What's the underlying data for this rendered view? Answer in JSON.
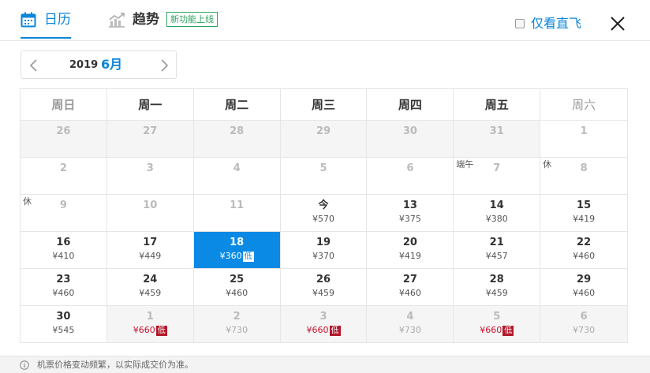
{
  "tabs": {
    "calendar": "日历",
    "trend": "趋势",
    "trend_badge": "新功能上线"
  },
  "direct_only": {
    "label": "仅看直飞",
    "checked": false
  },
  "month_picker": {
    "year": "2019",
    "month": "6月"
  },
  "weekdays": [
    "周日",
    "周一",
    "周二",
    "周三",
    "周四",
    "周五",
    "周六"
  ],
  "weeks": [
    [
      {
        "day": "26",
        "price": "",
        "state": "past-month"
      },
      {
        "day": "27",
        "price": "",
        "state": "past-month"
      },
      {
        "day": "28",
        "price": "",
        "state": "past-month"
      },
      {
        "day": "29",
        "price": "",
        "state": "past-month"
      },
      {
        "day": "30",
        "price": "",
        "state": "past-month"
      },
      {
        "day": "31",
        "price": "",
        "state": "past-month"
      },
      {
        "day": "1",
        "price": "",
        "state": "disabled"
      }
    ],
    [
      {
        "day": "2",
        "price": "",
        "state": "disabled"
      },
      {
        "day": "3",
        "price": "",
        "state": "disabled"
      },
      {
        "day": "4",
        "price": "",
        "state": "disabled"
      },
      {
        "day": "5",
        "price": "",
        "state": "disabled"
      },
      {
        "day": "6",
        "price": "",
        "state": "disabled"
      },
      {
        "day": "7",
        "price": "",
        "state": "disabled",
        "tag": "端午"
      },
      {
        "day": "8",
        "price": "",
        "state": "disabled",
        "tag": "休"
      }
    ],
    [
      {
        "day": "9",
        "price": "",
        "state": "disabled",
        "tag": "休"
      },
      {
        "day": "10",
        "price": "",
        "state": "disabled"
      },
      {
        "day": "11",
        "price": "",
        "state": "disabled"
      },
      {
        "day": "今",
        "price": "¥570",
        "state": "normal"
      },
      {
        "day": "13",
        "price": "¥375",
        "state": "normal"
      },
      {
        "day": "14",
        "price": "¥380",
        "state": "normal"
      },
      {
        "day": "15",
        "price": "¥419",
        "state": "normal"
      }
    ],
    [
      {
        "day": "16",
        "price": "¥410",
        "state": "normal"
      },
      {
        "day": "17",
        "price": "¥449",
        "state": "normal"
      },
      {
        "day": "18",
        "price": "¥360",
        "state": "selected",
        "low": "低"
      },
      {
        "day": "19",
        "price": "¥370",
        "state": "normal"
      },
      {
        "day": "20",
        "price": "¥419",
        "state": "normal"
      },
      {
        "day": "21",
        "price": "¥457",
        "state": "normal"
      },
      {
        "day": "22",
        "price": "¥460",
        "state": "normal"
      }
    ],
    [
      {
        "day": "23",
        "price": "¥460",
        "state": "normal"
      },
      {
        "day": "24",
        "price": "¥459",
        "state": "normal"
      },
      {
        "day": "25",
        "price": "¥460",
        "state": "normal"
      },
      {
        "day": "26",
        "price": "¥459",
        "state": "normal"
      },
      {
        "day": "27",
        "price": "¥460",
        "state": "normal"
      },
      {
        "day": "28",
        "price": "¥459",
        "state": "normal"
      },
      {
        "day": "29",
        "price": "¥460",
        "state": "normal"
      }
    ],
    [
      {
        "day": "30",
        "price": "¥545",
        "state": "normal"
      },
      {
        "day": "1",
        "price": "¥660",
        "state": "next-month",
        "low": "低"
      },
      {
        "day": "2",
        "price": "¥730",
        "state": "next-month"
      },
      {
        "day": "3",
        "price": "¥660",
        "state": "next-month",
        "low": "低"
      },
      {
        "day": "4",
        "price": "¥730",
        "state": "next-month"
      },
      {
        "day": "5",
        "price": "¥660",
        "state": "next-month",
        "low": "低"
      },
      {
        "day": "6",
        "price": "¥730",
        "state": "next-month"
      }
    ]
  ],
  "footer_note": "机票价格变动频繁，以实际成交价为准。",
  "colors": {
    "accent": "#0a85d9",
    "selected_bg": "#0a8ae5",
    "low_price": "#c8102e",
    "badge_green": "#2aa35e"
  },
  "icons": {
    "calendar_tab": "calendar-icon",
    "trend_tab": "trend-chart-icon",
    "close": "close-icon",
    "prev": "chevron-left-icon",
    "next": "chevron-right-icon",
    "footer": "info-icon"
  }
}
